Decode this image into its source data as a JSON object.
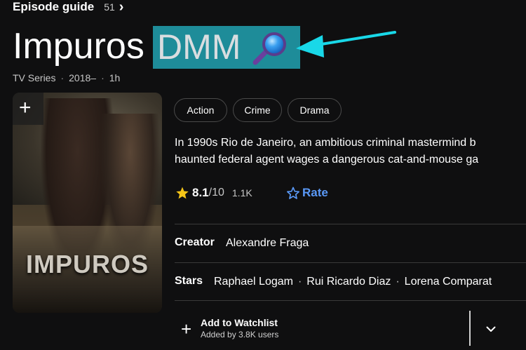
{
  "episode_guide": {
    "label": "Episode guide",
    "count": "51",
    "chevron": "›"
  },
  "title": "Impuros",
  "overlay": {
    "text": "DMM",
    "icon": "magnifying-glass-icon",
    "box_color": "#1e8c99",
    "arrow_color": "#19d8e8"
  },
  "meta": {
    "type": "TV Series",
    "years": "2018–",
    "runtime": "1h"
  },
  "poster": {
    "title": "IMPUROS",
    "add_icon": "+"
  },
  "genres": [
    "Action",
    "Crime",
    "Drama"
  ],
  "plot": {
    "line1": "In 1990s Rio de Janeiro, an ambitious criminal mastermind b",
    "line2": "haunted federal agent wages a dangerous cat-and-mouse ga"
  },
  "rating": {
    "value": "8.1",
    "max": "/10",
    "count": "1.1K",
    "star_color": "#f5c518"
  },
  "rate": {
    "label": "Rate",
    "color": "#5a99f7"
  },
  "credits": {
    "creator_label": "Creator",
    "creator": "Alexandre Fraga",
    "stars_label": "Stars",
    "stars": [
      "Raphael Logam",
      "Rui Ricardo Diaz",
      "Lorena Comparat"
    ]
  },
  "watchlist": {
    "label": "Add to Watchlist",
    "sub": "Added by 3.8K users",
    "plus": "+",
    "dropdown_icon": "chevron-down-icon"
  }
}
